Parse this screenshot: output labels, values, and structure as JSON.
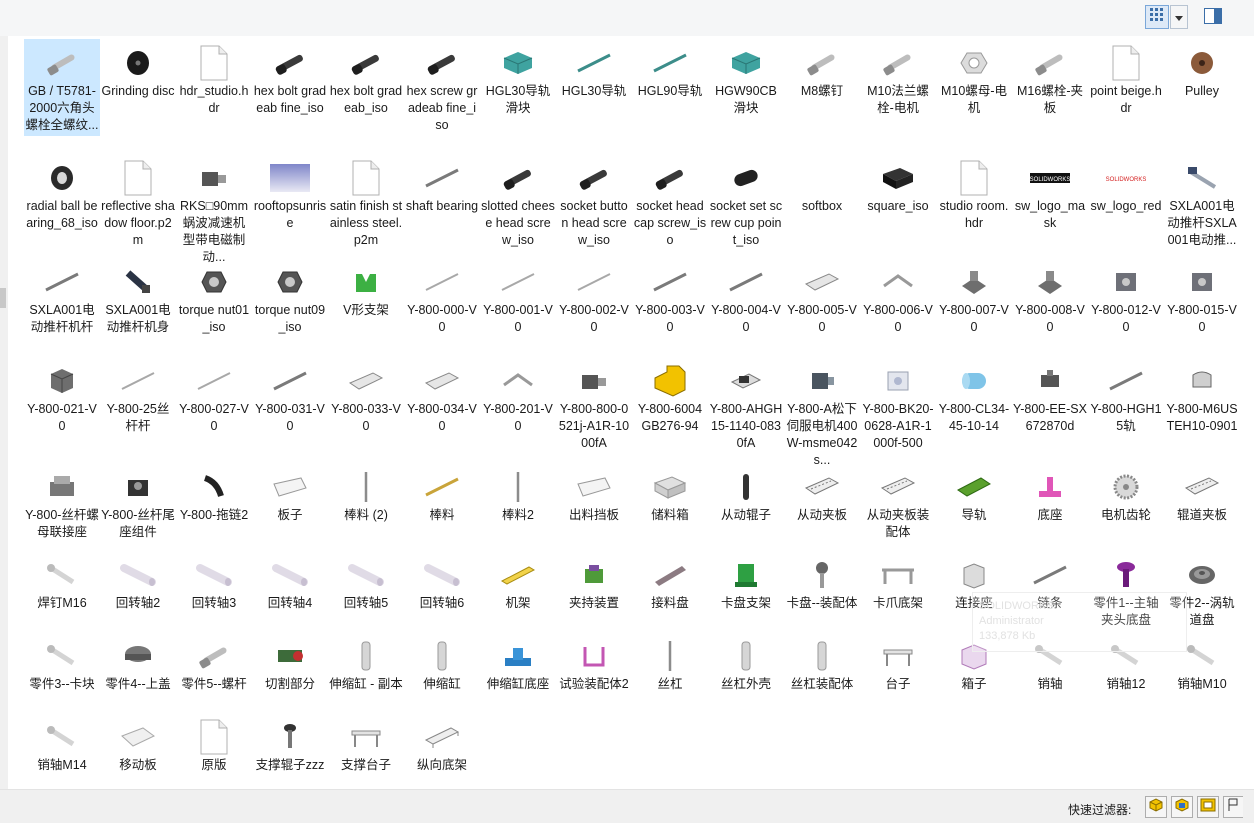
{
  "toolbar": {
    "view_icon": "large-icons-view-icon",
    "dropdown_icon": "chevron-down-icon",
    "preview_icon": "preview-pane-icon"
  },
  "watermark": {
    "line1": "SOLIDWORKS",
    "line2": "Administrator",
    "line3": "133,878 Kb"
  },
  "status": {
    "filter_label": "快速过滤器:"
  },
  "items": [
    {
      "label": "GB / T5781-2000六角头螺栓全螺纹...",
      "thumb": "bolt",
      "selected": true
    },
    {
      "label": "Grinding disc",
      "thumb": "disc"
    },
    {
      "label": "hdr_studio.hdr",
      "thumb": "doc"
    },
    {
      "label": "hex bolt gradeab fine_iso",
      "thumb": "bolt-dark"
    },
    {
      "label": "hex bolt gradeab_iso",
      "thumb": "bolt-dark"
    },
    {
      "label": "hex screw gradeab fine_iso",
      "thumb": "bolt-dark"
    },
    {
      "label": "HGL30导轨 滑块",
      "thumb": "teal-block"
    },
    {
      "label": "HGL30导轨",
      "thumb": "teal-rod"
    },
    {
      "label": "HGL90导轨",
      "thumb": "teal-rod"
    },
    {
      "label": "HGW90CB滑块",
      "thumb": "teal-block"
    },
    {
      "label": "M8螺钉",
      "thumb": "bolt"
    },
    {
      "label": "M10法兰螺栓-电机",
      "thumb": "bolt"
    },
    {
      "label": "M10螺母-电机",
      "thumb": "nut-light"
    },
    {
      "label": "M16螺栓-夹板",
      "thumb": "bolt"
    },
    {
      "label": "point beige.hdr",
      "thumb": "doc"
    },
    {
      "label": "Pulley",
      "thumb": "pulley"
    },
    {
      "label": "radial ball bearing_68_iso",
      "thumb": "ring-dark"
    },
    {
      "label": "reflective shadow floor.p2m",
      "thumb": "doc"
    },
    {
      "label": "RKS□90mm蜗波减速机型带电磁制动...",
      "thumb": "motor"
    },
    {
      "label": "rooftopsunrise",
      "thumb": "gradient"
    },
    {
      "label": "satin finish stainless steel.p2m",
      "thumb": "doc"
    },
    {
      "label": "shaft bearing",
      "thumb": "rod"
    },
    {
      "label": "slotted cheese head screw_iso",
      "thumb": "bolt-dark"
    },
    {
      "label": "socket button head screw_iso",
      "thumb": "bolt-dark"
    },
    {
      "label": "socket head cap screw_iso",
      "thumb": "bolt-dark"
    },
    {
      "label": "socket set screw cup point_iso",
      "thumb": "setscrew"
    },
    {
      "label": "softbox",
      "thumb": "blank"
    },
    {
      "label": "square_iso",
      "thumb": "box-dark"
    },
    {
      "label": "studio room.hdr",
      "thumb": "doc"
    },
    {
      "label": "sw_logo_mask",
      "thumb": "logo-dark"
    },
    {
      "label": "sw_logo_red",
      "thumb": "logo-red"
    },
    {
      "label": "SXLA001电动推杆SXLA001电动推...",
      "thumb": "actuator"
    },
    {
      "label": "SXLA001电动推杆机杆",
      "thumb": "rod"
    },
    {
      "label": "SXLA001电动推杆机身",
      "thumb": "actuator-dark"
    },
    {
      "label": "torque nut01_iso",
      "thumb": "nut-dark"
    },
    {
      "label": "torque nut09_iso",
      "thumb": "nut-dark"
    },
    {
      "label": "V形支架",
      "thumb": "green-bracket"
    },
    {
      "label": "Y-800-000-V0",
      "thumb": "rod-thin"
    },
    {
      "label": "Y-800-001-V0",
      "thumb": "rod-thin"
    },
    {
      "label": "Y-800-002-V0",
      "thumb": "rod-thin"
    },
    {
      "label": "Y-800-003-V0",
      "thumb": "rod"
    },
    {
      "label": "Y-800-004-V0",
      "thumb": "rod"
    },
    {
      "label": "Y-800-005-V0",
      "thumb": "plate"
    },
    {
      "label": "Y-800-006-V0",
      "thumb": "angle"
    },
    {
      "label": "Y-800-007-V0",
      "thumb": "bracket-grey"
    },
    {
      "label": "Y-800-008-V0",
      "thumb": "bracket-grey"
    },
    {
      "label": "Y-800-012-V0",
      "thumb": "block-grey"
    },
    {
      "label": "Y-800-015-V0",
      "thumb": "block-grey"
    },
    {
      "label": "Y-800-021-V0",
      "thumb": "cube-grey"
    },
    {
      "label": "Y-800-25丝杆杆",
      "thumb": "rod-thin"
    },
    {
      "label": "Y-800-027-V0",
      "thumb": "rod-thin"
    },
    {
      "label": "Y-800-031-V0",
      "thumb": "rod"
    },
    {
      "label": "Y-800-033-V0",
      "thumb": "plate"
    },
    {
      "label": "Y-800-034-V0",
      "thumb": "plate"
    },
    {
      "label": "Y-800-201-V0",
      "thumb": "angle"
    },
    {
      "label": "Y-800-800-0521j-A1R-1000fA",
      "thumb": "motor"
    },
    {
      "label": "Y-800-6004 GB276-94",
      "thumb": "yellow-block"
    },
    {
      "label": "Y-800-AHGH15-1140-0830fA",
      "thumb": "slide"
    },
    {
      "label": "Y-800-A松下伺服电机400W-msme042s...",
      "thumb": "motor-dark"
    },
    {
      "label": "Y-800-BK20-0628-A1R-1000f-500",
      "thumb": "block-light"
    },
    {
      "label": "Y-800-CL34-45-10-14",
      "thumb": "cyl-blue"
    },
    {
      "label": "Y-800-EE-SX672870d",
      "thumb": "sensor"
    },
    {
      "label": "Y-800-HGH15轨",
      "thumb": "rod"
    },
    {
      "label": "Y-800-M6USTEH10-0901",
      "thumb": "clamp"
    },
    {
      "label": "Y-800-丝杆螺母联接座",
      "thumb": "assembly"
    },
    {
      "label": "Y-800-丝杆尾座组件",
      "thumb": "block-dark"
    },
    {
      "label": "Y-800-拖链2",
      "thumb": "chain"
    },
    {
      "label": "板子",
      "thumb": "board"
    },
    {
      "label": "棒料 (2)",
      "thumb": "stick"
    },
    {
      "label": "棒料",
      "thumb": "stick-gold"
    },
    {
      "label": "棒料2",
      "thumb": "stick"
    },
    {
      "label": "出料挡板",
      "thumb": "board"
    },
    {
      "label": "储料箱",
      "thumb": "box-light"
    },
    {
      "label": "从动辊子",
      "thumb": "roller"
    },
    {
      "label": "从动夹板",
      "thumb": "rail-plate"
    },
    {
      "label": "从动夹板装配体",
      "thumb": "rail-plate"
    },
    {
      "label": "导轨",
      "thumb": "green-rail"
    },
    {
      "label": "底座",
      "thumb": "pink-base"
    },
    {
      "label": "电机齿轮",
      "thumb": "gear"
    },
    {
      "label": "辊道夹板",
      "thumb": "rail-plate"
    },
    {
      "label": "焊钉M16",
      "thumb": "pin"
    },
    {
      "label": "回转轴2",
      "thumb": "shaft"
    },
    {
      "label": "回转轴3",
      "thumb": "shaft"
    },
    {
      "label": "回转轴4",
      "thumb": "shaft"
    },
    {
      "label": "回转轴5",
      "thumb": "shaft"
    },
    {
      "label": "回转轴6",
      "thumb": "shaft"
    },
    {
      "label": "机架",
      "thumb": "yellow-bar"
    },
    {
      "label": "夹持装置",
      "thumb": "green-gripper"
    },
    {
      "label": "接料盘",
      "thumb": "tray"
    },
    {
      "label": "卡盘支架",
      "thumb": "green-stand"
    },
    {
      "label": "卡盘--装配体",
      "thumb": "chuck"
    },
    {
      "label": "卡爪底架",
      "thumb": "frame"
    },
    {
      "label": "连接座",
      "thumb": "connector"
    },
    {
      "label": "链条",
      "thumb": "rod"
    },
    {
      "label": "零件1--主轴夹头底盘",
      "thumb": "purple-spindle"
    },
    {
      "label": "零件2--涡轨道盘",
      "thumb": "coil"
    },
    {
      "label": "零件3--卡块",
      "thumb": "pin"
    },
    {
      "label": "零件4--上盖",
      "thumb": "cap"
    },
    {
      "label": "零件5--螺杆",
      "thumb": "bolt"
    },
    {
      "label": "切割部分",
      "thumb": "cutter"
    },
    {
      "label": "伸缩缸 - 副本",
      "thumb": "cylinder-v"
    },
    {
      "label": "伸缩缸",
      "thumb": "cylinder-v"
    },
    {
      "label": "伸缩缸底座",
      "thumb": "blue-base"
    },
    {
      "label": "试验装配体2",
      "thumb": "u-frame"
    },
    {
      "label": "丝杠",
      "thumb": "stick"
    },
    {
      "label": "丝杠外壳",
      "thumb": "cylinder-v"
    },
    {
      "label": "丝杠装配体",
      "thumb": "cylinder-v"
    },
    {
      "label": "台子",
      "thumb": "table"
    },
    {
      "label": "箱子",
      "thumb": "box-pink"
    },
    {
      "label": "销轴",
      "thumb": "pin"
    },
    {
      "label": "销轴12",
      "thumb": "pin"
    },
    {
      "label": "销轴M10",
      "thumb": "pin"
    },
    {
      "label": "销轴M14",
      "thumb": "pin"
    },
    {
      "label": "移动板",
      "thumb": "board-light"
    },
    {
      "label": "原版",
      "thumb": "doc"
    },
    {
      "label": "支撑辊子zzz",
      "thumb": "support"
    },
    {
      "label": "支撑台子",
      "thumb": "table"
    },
    {
      "label": "纵向底架",
      "thumb": "frame-long"
    }
  ]
}
